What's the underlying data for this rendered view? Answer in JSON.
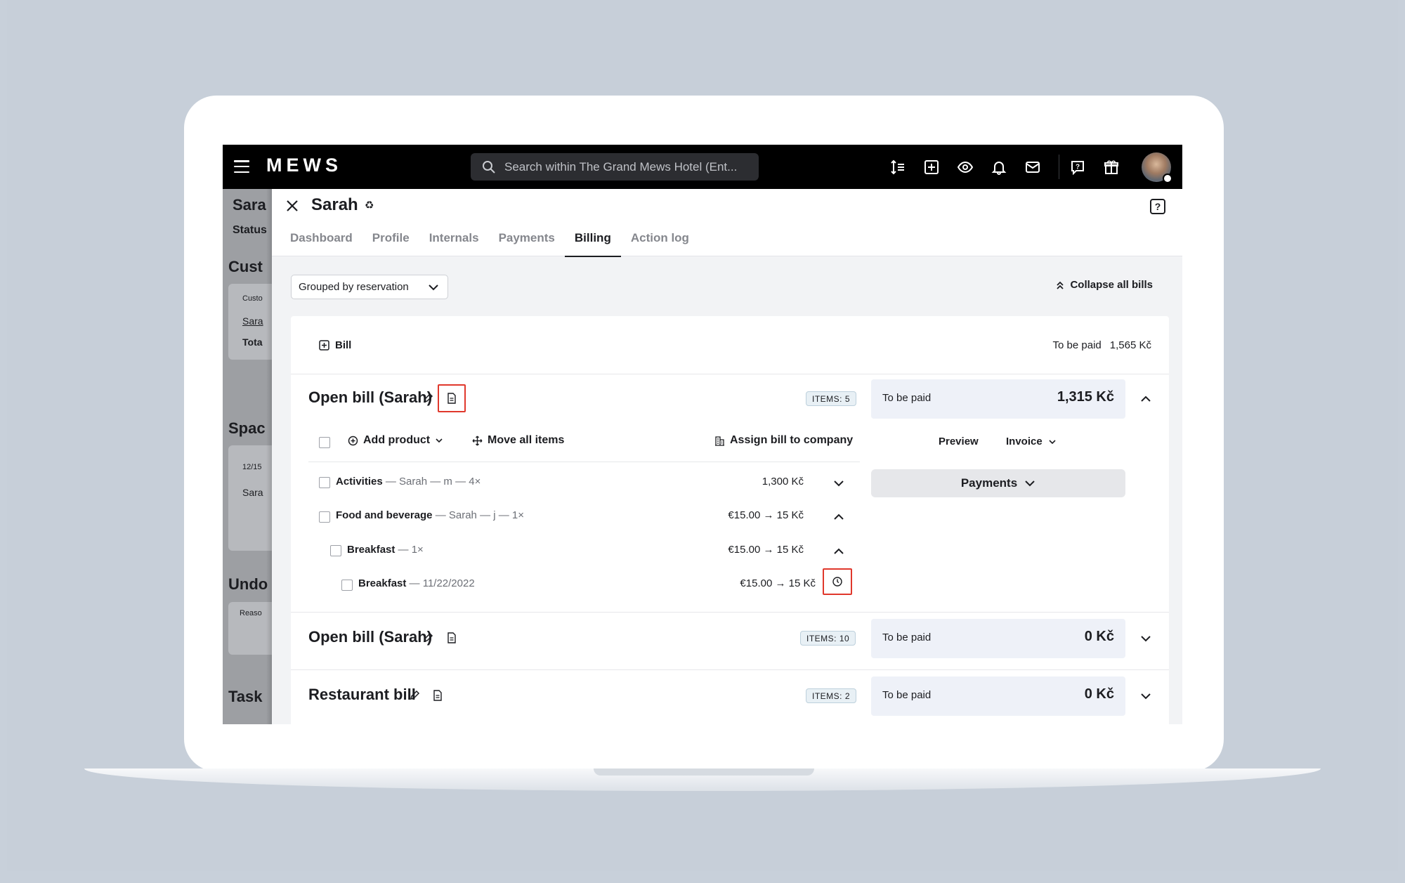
{
  "app": {
    "logo": "MEWS"
  },
  "search": {
    "placeholder": "Search within The Grand Mews Hotel (Ent..."
  },
  "background_page": {
    "title": "Sara",
    "status": "Status",
    "section_customer": "Cust",
    "customer_label": "Custo",
    "customer_link": "Sara",
    "total": "Tota",
    "section_space": "Spac",
    "space_date": "12/15",
    "space_name": "Sara",
    "section_undo": "Undo",
    "reason": "Reaso",
    "section_task": "Task"
  },
  "drawer": {
    "title": "Sarah",
    "tabs": [
      {
        "label": "Dashboard"
      },
      {
        "label": "Profile"
      },
      {
        "label": "Internals"
      },
      {
        "label": "Payments"
      },
      {
        "label": "Billing"
      },
      {
        "label": "Action log"
      }
    ],
    "active_tab": "Billing"
  },
  "toolbar": {
    "grouping": "Grouped by reservation",
    "collapse_all": "Collapse all bills"
  },
  "summary": {
    "add_bill": "Bill",
    "to_be_paid_label": "To be paid",
    "to_be_paid_amount": "1,565 Kč"
  },
  "bills": [
    {
      "title": "Open bill (Sarah)",
      "items_badge": "ITEMS: 5",
      "to_be_paid_label": "To be paid",
      "amount": "1,315 Kč",
      "expanded": true,
      "actions": {
        "add_product": "Add product",
        "move_all": "Move all items",
        "assign_company": "Assign bill to company",
        "preview": "Preview",
        "invoice": "Invoice",
        "payments": "Payments"
      },
      "lines": [
        {
          "name": "Activities",
          "detail": "— Sarah — m — 4×",
          "amount": "1,300 Kč"
        },
        {
          "name": "Food and beverage",
          "detail": "— Sarah — j — 1×",
          "amount": "€15.00 → 15 Kč"
        },
        {
          "name": "Breakfast",
          "detail": "— 1×",
          "amount": "€15.00 → 15 Kč"
        },
        {
          "name": "Breakfast",
          "detail": "— 11/22/2022",
          "amount": "€15.00 → 15 Kč"
        }
      ]
    },
    {
      "title": "Open bill (Sarah)",
      "items_badge": "ITEMS: 10",
      "to_be_paid_label": "To be paid",
      "amount": "0 Kč",
      "expanded": false
    },
    {
      "title": "Restaurant bill",
      "items_badge": "ITEMS: 2",
      "to_be_paid_label": "To be paid",
      "amount": "0 Kč",
      "expanded": false
    }
  ],
  "colors": {
    "highlight": "#e0382c",
    "topbar": "#000000",
    "to_be_paid_bg": "#eef1f8"
  }
}
